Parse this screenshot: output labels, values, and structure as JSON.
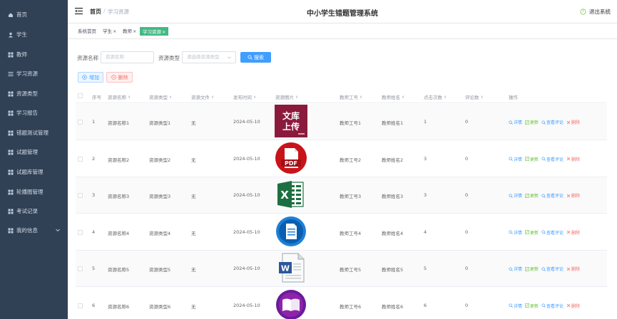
{
  "sidebar": {
    "items": [
      {
        "label": "首页",
        "icon": "home-icon"
      },
      {
        "label": "学生",
        "icon": "user-icon"
      },
      {
        "label": "教师",
        "icon": "grid-icon"
      },
      {
        "label": "学习资源",
        "icon": "list-icon"
      },
      {
        "label": "资源类型",
        "icon": "grid-icon"
      },
      {
        "label": "学习报告",
        "icon": "grid-icon"
      },
      {
        "label": "错题测试管理",
        "icon": "grid-icon"
      },
      {
        "label": "试题管理",
        "icon": "grid-icon"
      },
      {
        "label": "试题库管理",
        "icon": "grid-icon"
      },
      {
        "label": "轮播图管理",
        "icon": "grid-icon"
      },
      {
        "label": "考试记录",
        "icon": "grid-icon"
      },
      {
        "label": "我的信息",
        "icon": "grid-icon"
      }
    ]
  },
  "navbar": {
    "breadcrumb_home": "首页",
    "breadcrumb_sep": "/",
    "breadcrumb_current": "学习资源",
    "title": "中小学生错题管理系统",
    "logout": "退出系统"
  },
  "tags": [
    {
      "label": "系统首页",
      "closable": false
    },
    {
      "label": "学生",
      "closable": true
    },
    {
      "label": "教师",
      "closable": true
    },
    {
      "label": "学习资源",
      "closable": true,
      "active": true
    }
  ],
  "search": {
    "name_label": "资源名称",
    "name_placeholder": "资源名称",
    "type_label": "资源类型",
    "type_placeholder": "请选择资源类型",
    "button": "搜索"
  },
  "actions": {
    "add": "增加",
    "delete": "删除"
  },
  "table": {
    "headers": [
      "序号",
      "资源名称",
      "资源类型",
      "资源文件",
      "发布时间",
      "资源图片",
      "教师工号",
      "教师姓名",
      "点击次数",
      "评论数",
      "操作"
    ],
    "ops": {
      "detail": "详情",
      "edit": "更新",
      "review": "查看评论",
      "remove": "删除"
    },
    "rows": [
      {
        "index": "1",
        "name": "资源名称1",
        "type": "资源类型1",
        "file": "无",
        "date": "2024-05-10",
        "image": "wenku",
        "teacher_no": "教师工号1",
        "teacher_name": "教师姓名1",
        "clicks": "1",
        "comments": "0"
      },
      {
        "index": "2",
        "name": "资源名称2",
        "type": "资源类型2",
        "file": "无",
        "date": "2024-05-10",
        "image": "pdf",
        "teacher_no": "教师工号2",
        "teacher_name": "教师姓名2",
        "clicks": "3",
        "comments": "0"
      },
      {
        "index": "3",
        "name": "资源名称3",
        "type": "资源类型3",
        "file": "无",
        "date": "2024-05-10",
        "image": "excel",
        "teacher_no": "教师工号3",
        "teacher_name": "教师姓名3",
        "clicks": "3",
        "comments": "0"
      },
      {
        "index": "4",
        "name": "资源名称4",
        "type": "资源类型4",
        "file": "无",
        "date": "2024-05-10",
        "image": "document",
        "teacher_no": "教师工号4",
        "teacher_name": "教师姓名4",
        "clicks": "4",
        "comments": "0"
      },
      {
        "index": "5",
        "name": "资源名称5",
        "type": "资源类型5",
        "file": "无",
        "date": "2024-05-10",
        "image": "word",
        "teacher_no": "教师工号5",
        "teacher_name": "教师姓名5",
        "clicks": "5",
        "comments": "0"
      },
      {
        "index": "6",
        "name": "资源名称6",
        "type": "资源类型6",
        "file": "无",
        "date": "2024-05-10",
        "image": "book",
        "teacher_no": "教师工号6",
        "teacher_name": "教师姓名6",
        "clicks": "6",
        "comments": "0"
      }
    ]
  },
  "thumb_text": {
    "wenku_line1": "文库",
    "wenku_line2": "上传",
    "pdf": "PDF",
    "excel": "X",
    "word": "W"
  },
  "colors": {
    "sidebar_bg": "#304156",
    "primary": "#409eff",
    "tag_active": "#42b983",
    "danger": "#f56c6c",
    "success": "#67c23a"
  }
}
